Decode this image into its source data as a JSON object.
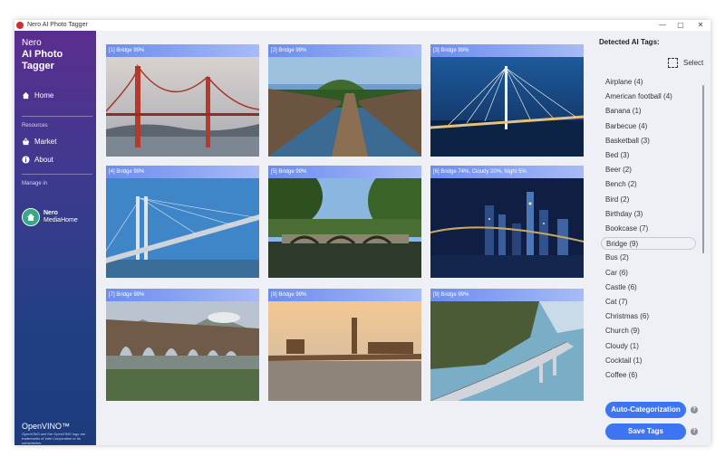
{
  "window": {
    "title": "Nero AI Photo Tagger",
    "controls": [
      "—",
      "▢",
      "✕"
    ]
  },
  "brand": {
    "line1": "Nero",
    "line2": "AI Photo",
    "line3": "Tagger"
  },
  "nav": {
    "home": "Home",
    "resources_label": "Resources",
    "market": "Market",
    "about": "About",
    "manage_label": "Manage in",
    "mediahome_line1": "Nero",
    "mediahome_line2": "MediaHome"
  },
  "openvino": {
    "logo": "OpenVINO™",
    "note": "OpenVINO and the OpenVINO logo are trademarks of Intel Corporation or its subsidiaries."
  },
  "photos": [
    {
      "label": "[1] Bridge 99%",
      "subject": "golden-gate-bridge"
    },
    {
      "label": "[2] Bridge 99%",
      "subject": "wooden-boardwalk-bridge"
    },
    {
      "label": "[3] Bridge 99%",
      "subject": "cable-stayed-bridge-night"
    },
    {
      "label": "[4] Bridge 99%",
      "subject": "cable-stayed-bridge-day"
    },
    {
      "label": "[5] Bridge 99%",
      "subject": "stone-arch-bridge"
    },
    {
      "label": "[6] Bridge 74%, Cloudy 20%, Night 5%",
      "subject": "city-skyline-night"
    },
    {
      "label": "[7] Bridge 99%",
      "subject": "railway-viaduct"
    },
    {
      "label": "[8] Bridge 99%",
      "subject": "westminster-bridge"
    },
    {
      "label": "[9] Bridge 99%",
      "subject": "coastal-road-bridge"
    }
  ],
  "tags_panel": {
    "title": "Detected AI Tags:",
    "select_label": "Select",
    "tags": [
      "Airplane (4)",
      "American football (4)",
      "Banana (1)",
      "Barbecue (4)",
      "Basketball (3)",
      "Bed (3)",
      "Beer (2)",
      "Bench (2)",
      "Bird (2)",
      "Birthday (3)",
      "Bookcase (7)",
      "Bridge (9)",
      "Bus (2)",
      "Car (6)",
      "Castle (6)",
      "Cat (7)",
      "Christmas (6)",
      "Church (9)",
      "Cloudy (1)",
      "Cocktail (1)",
      "Coffee (6)"
    ],
    "active_tag": "Bridge (9)",
    "auto_button": "Auto-Categorization",
    "save_button": "Save Tags",
    "help_glyph": "?"
  },
  "colors": {
    "accent": "#3d74f2",
    "sidebar_top": "#5b2d8f",
    "sidebar_bottom": "#1c3b7c",
    "label_bar": "#6c8cf0"
  }
}
